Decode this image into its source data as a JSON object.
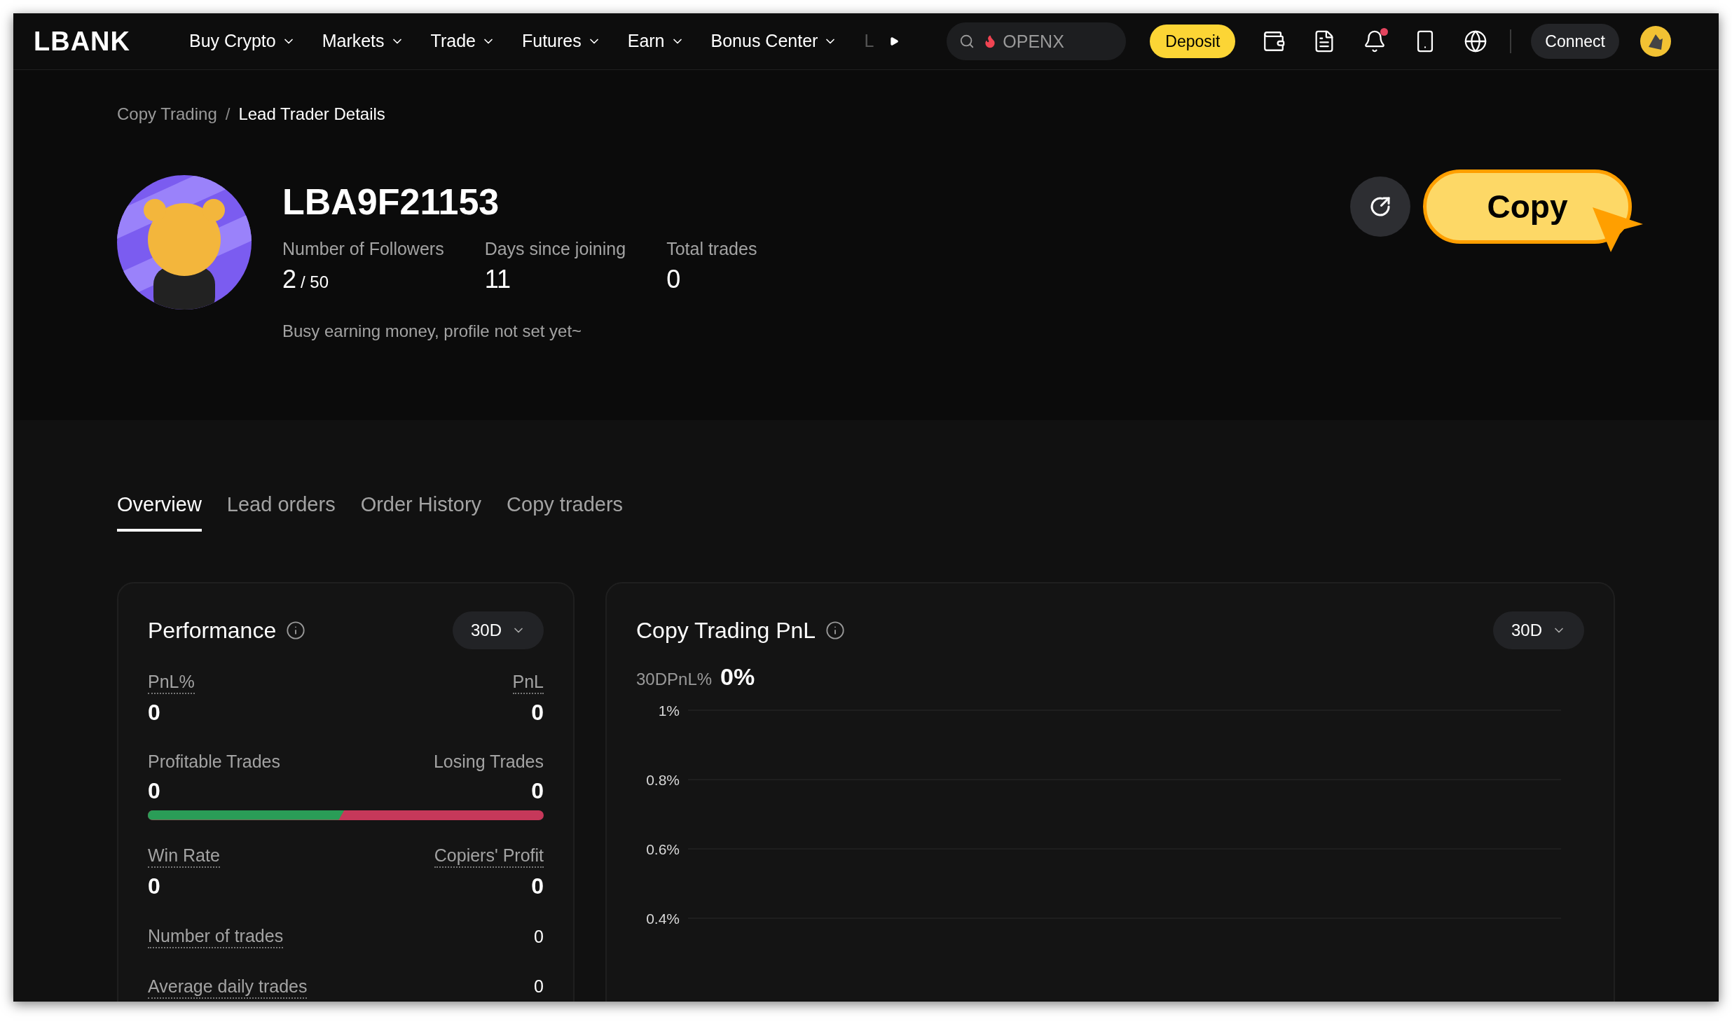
{
  "header": {
    "logo": "LBANK",
    "nav": [
      {
        "label": "Buy Crypto",
        "dropdown": true,
        "faded": false
      },
      {
        "label": "Markets",
        "dropdown": true,
        "faded": false
      },
      {
        "label": "Trade",
        "dropdown": true,
        "faded": false
      },
      {
        "label": "Futures",
        "dropdown": true,
        "faded": false
      },
      {
        "label": "Earn",
        "dropdown": true,
        "faded": false
      },
      {
        "label": "Bonus Center",
        "dropdown": true,
        "faded": false
      },
      {
        "label": "L",
        "dropdown": false,
        "faded": true
      }
    ],
    "search": {
      "placeholder": "OPENX"
    },
    "deposit": "Deposit",
    "notifications": {
      "unread": true
    },
    "connect": "Connect"
  },
  "breadcrumb_separator": "/",
  "breadcrumb": [
    {
      "label": "Copy Trading",
      "current": false
    },
    {
      "label": "Lead Trader Details",
      "current": true
    }
  ],
  "trader": {
    "name": "LBA9F21153",
    "stats": [
      {
        "label": "Number of Followers",
        "value": "2",
        "limit": "/ 50"
      },
      {
        "label": "Days since joining",
        "value": "11"
      },
      {
        "label": "Total trades",
        "value": "0"
      }
    ],
    "bio": "Busy earning money, profile not set yet~"
  },
  "copy_button": "Copy",
  "tabs": [
    {
      "label": "Overview",
      "selected": true
    },
    {
      "label": "Lead orders",
      "selected": false
    },
    {
      "label": "Order History",
      "selected": false
    },
    {
      "label": "Copy traders",
      "selected": false
    }
  ],
  "performance": {
    "title": "Performance",
    "period": "30D",
    "rows": [
      {
        "kind": "pair",
        "left_label": "PnL%",
        "left_value": "0",
        "right_label": "PnL",
        "right_value": "0",
        "underlined": true
      },
      {
        "kind": "ratio",
        "left_label": "Profitable Trades",
        "left_value": "0",
        "right_label": "Losing Trades",
        "right_value": "0",
        "underlined": false,
        "level": 0.5
      },
      {
        "kind": "pair",
        "left_label": "Win Rate",
        "left_value": "0",
        "right_label": "Copiers' Profit",
        "right_value": "0",
        "underlined": true
      },
      {
        "kind": "line",
        "label": "Number of trades",
        "value": "0",
        "underlined": true
      },
      {
        "kind": "line",
        "label": "Average daily trades",
        "value": "0",
        "underlined": true
      }
    ]
  },
  "pnl": {
    "title": "Copy Trading PnL",
    "period": "30D",
    "summary_label": "30DPnL%",
    "summary_value": "0%",
    "axis_labels": [
      "1%",
      "0.8%",
      "0.6%",
      "0.4%"
    ]
  }
}
